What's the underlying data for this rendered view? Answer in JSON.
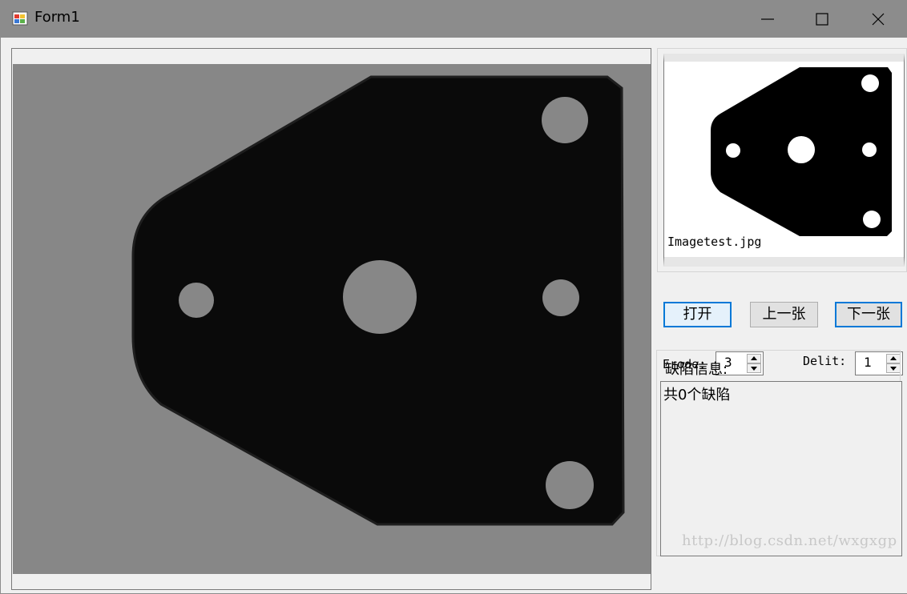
{
  "window": {
    "title": "Form1",
    "controls": {
      "minimize": "minimize-icon",
      "maximize": "maximize-icon",
      "close": "close-icon"
    }
  },
  "image_panel": {
    "filename": "Imagetest.jpg"
  },
  "buttons": {
    "open": "打开",
    "prev": "上一张",
    "next": "下一张"
  },
  "params": {
    "erode": {
      "label": "Erode:",
      "value": "3"
    },
    "delit": {
      "label": "Delit:",
      "value": "1"
    }
  },
  "defects": {
    "title": "缺陷信息:",
    "text": "共0个缺陷"
  },
  "watermark": "http://blog.csdn.net/wxgxgp",
  "colors": {
    "titlebar": "#8c8c8c",
    "accent": "#0078d7",
    "part": "#0a0a0a",
    "image_bg": "#878787"
  }
}
